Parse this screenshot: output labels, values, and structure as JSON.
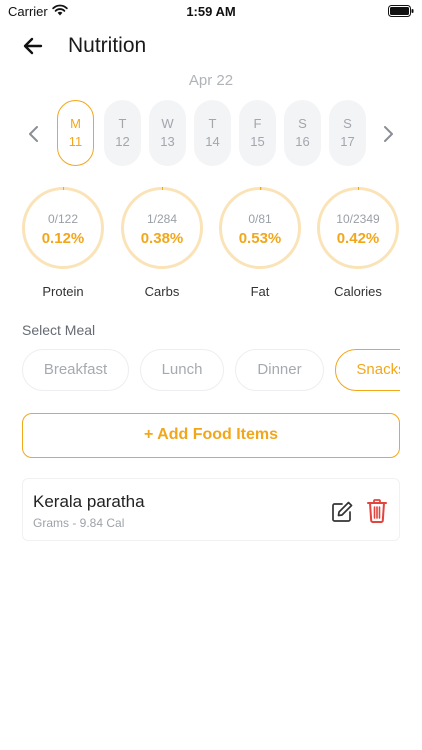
{
  "status_bar": {
    "carrier": "Carrier",
    "time": "1:59 AM"
  },
  "header": {
    "title": "Nutrition"
  },
  "date": {
    "label": "Apr 22"
  },
  "week": {
    "days": [
      {
        "letter": "M",
        "num": "11",
        "selected": true
      },
      {
        "letter": "T",
        "num": "12",
        "selected": false
      },
      {
        "letter": "W",
        "num": "13",
        "selected": false
      },
      {
        "letter": "T",
        "num": "14",
        "selected": false
      },
      {
        "letter": "F",
        "num": "15",
        "selected": false
      },
      {
        "letter": "S",
        "num": "16",
        "selected": false
      },
      {
        "letter": "S",
        "num": "17",
        "selected": false
      }
    ]
  },
  "nutrients": [
    {
      "name": "Protein",
      "count": "0/122",
      "percent": "0.12%",
      "progress": 0.0012
    },
    {
      "name": "Carbs",
      "count": "1/284",
      "percent": "0.38%",
      "progress": 0.0038
    },
    {
      "name": "Fat",
      "count": "0/81",
      "percent": "0.53%",
      "progress": 0.0053
    },
    {
      "name": "Calories",
      "count": "10/2349",
      "percent": "0.42%",
      "progress": 0.0042
    }
  ],
  "meal": {
    "heading": "Select Meal",
    "options": [
      "Breakfast",
      "Lunch",
      "Dinner",
      "Snacks"
    ],
    "selected": "Snacks"
  },
  "add_button": {
    "label": "+ Add Food Items"
  },
  "food_items": [
    {
      "name": "Kerala paratha",
      "meta": "Grams - 9.84 Cal"
    }
  ],
  "colors": {
    "accent": "#f2a71b",
    "ring_track": "#fbe3b8",
    "delete": "#e0453e",
    "muted": "#a2a6ad"
  },
  "icons": [
    "wifi-icon",
    "battery-icon",
    "back-arrow-icon",
    "chevron-left-icon",
    "chevron-right-icon",
    "edit-icon",
    "trash-icon"
  ]
}
